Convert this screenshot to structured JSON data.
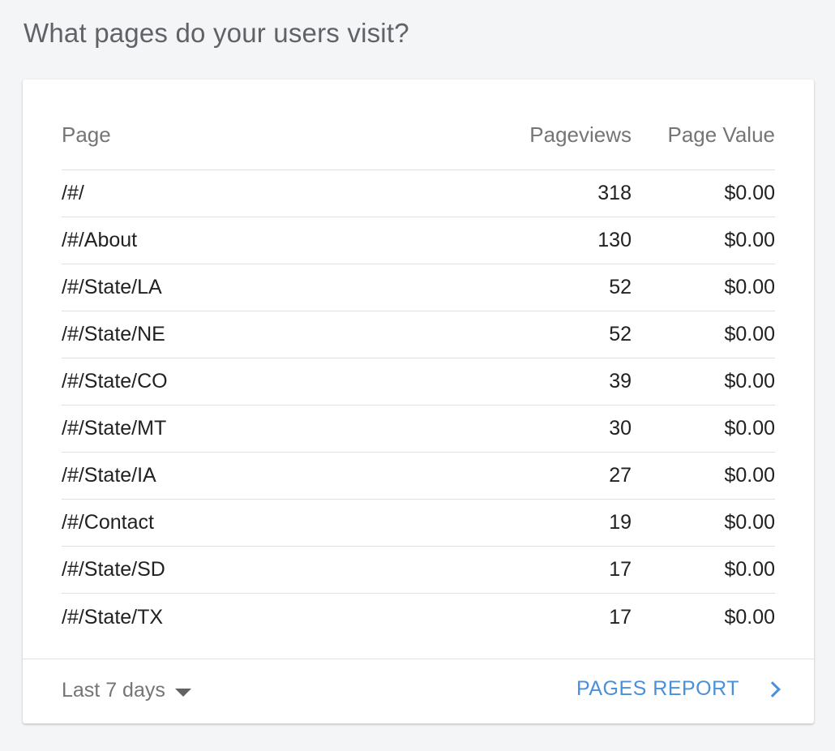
{
  "section": {
    "title": "What pages do your users visit?"
  },
  "table": {
    "headers": {
      "page": "Page",
      "pageviews": "Pageviews",
      "page_value": "Page Value"
    },
    "rows": [
      {
        "page": "/#/",
        "pageviews": "318",
        "page_value": "$0.00"
      },
      {
        "page": "/#/About",
        "pageviews": "130",
        "page_value": "$0.00"
      },
      {
        "page": "/#/State/LA",
        "pageviews": "52",
        "page_value": "$0.00"
      },
      {
        "page": "/#/State/NE",
        "pageviews": "52",
        "page_value": "$0.00"
      },
      {
        "page": "/#/State/CO",
        "pageviews": "39",
        "page_value": "$0.00"
      },
      {
        "page": "/#/State/MT",
        "pageviews": "30",
        "page_value": "$0.00"
      },
      {
        "page": "/#/State/IA",
        "pageviews": "27",
        "page_value": "$0.00"
      },
      {
        "page": "/#/Contact",
        "pageviews": "19",
        "page_value": "$0.00"
      },
      {
        "page": "/#/State/SD",
        "pageviews": "17",
        "page_value": "$0.00"
      },
      {
        "page": "/#/State/TX",
        "pageviews": "17",
        "page_value": "$0.00"
      }
    ]
  },
  "footer": {
    "date_range": "Last 7 days",
    "date_range_icon": "caret-down-icon",
    "report_link": "PAGES REPORT",
    "report_link_icon": "chevron-right-icon"
  },
  "colors": {
    "accent": "#4a90d9",
    "background": "#f4f5f7",
    "card": "#ffffff"
  }
}
